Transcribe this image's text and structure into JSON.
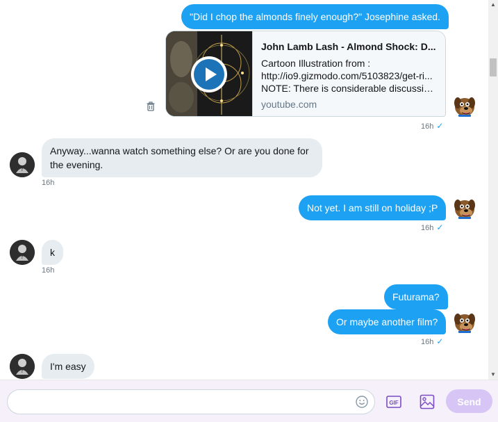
{
  "messages": [
    {
      "direction": "out",
      "text": "\"Did I chop the almonds finely enough?\" Josephine asked."
    },
    {
      "direction": "out",
      "type": "link-card",
      "card": {
        "title": "John Lamb Lash - Almond Shock: D...",
        "line1": "Cartoon Illustration from :",
        "line2": "http://io9.gizmodo.com/5103823/get-ri...",
        "line3": "NOTE: There is considerable discussio...",
        "domain": "youtube.com"
      },
      "time": "16h",
      "read": true
    },
    {
      "direction": "in",
      "text_line1": "Anyway...wanna watch something else? Or are you done for",
      "text_line2": "the evening.",
      "time": "16h"
    },
    {
      "direction": "out",
      "text": "Not yet. I am still on holiday ;P",
      "time": "16h",
      "read": true
    },
    {
      "direction": "in",
      "text": "k",
      "time": "16h"
    },
    {
      "direction": "out",
      "text": "Futurama?"
    },
    {
      "direction": "out",
      "text": "Or maybe another film?",
      "time": "16h",
      "read": true
    },
    {
      "direction": "in",
      "text": "I'm easy"
    }
  ],
  "icons": {
    "read_receipt": "✓",
    "trash": "trash-icon",
    "emoji": "smiley-icon",
    "gif": "GIF",
    "image": "image-icon"
  },
  "composer": {
    "placeholder": "",
    "send_label": "Send"
  },
  "colors": {
    "outgoing_bubble": "#1da1f2",
    "incoming_bubble": "#e6ecf0",
    "accent": "#794bc4",
    "send_disabled": "#d6c5f5"
  }
}
